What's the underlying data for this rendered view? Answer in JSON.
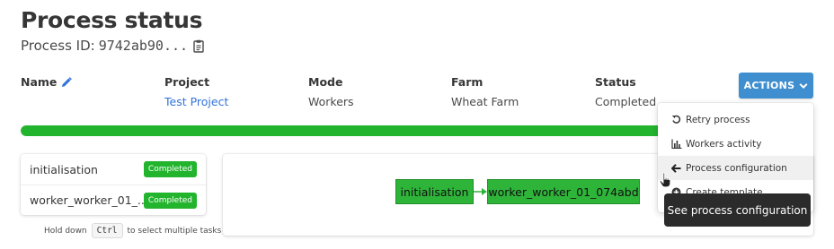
{
  "header": {
    "title": "Process status",
    "process_id_label": "Process ID:",
    "process_id_value": "9742ab90...",
    "icons": {
      "copy": "clipboard-icon",
      "edit": "pencil-icon"
    }
  },
  "fields": {
    "name_label": "Name",
    "project_label": "Project",
    "project_value": "Test Project",
    "mode_label": "Mode",
    "mode_value": "Workers",
    "farm_label": "Farm",
    "farm_value": "Wheat Farm",
    "status_label": "Status",
    "status_value": "Completed"
  },
  "actions": {
    "label": "ACTIONS",
    "icon": "chevron-down-icon",
    "color": "#3e8ed0"
  },
  "progress": {
    "fraction": 1.0,
    "color": "#23b42e"
  },
  "tasks": [
    {
      "name": "initialisation",
      "status": "Completed"
    },
    {
      "name": "worker_worker_01_...",
      "status": "Completed"
    }
  ],
  "hint": {
    "before": "Hold down",
    "key": "Ctrl",
    "after": "to select multiple tasks"
  },
  "graph": {
    "nodes": [
      "initialisation",
      "worker_worker_01_074abd"
    ],
    "node_color": "#2fb43a"
  },
  "menu": {
    "items": [
      {
        "label": "Retry process",
        "icon": "retry-icon"
      },
      {
        "label": "Workers activity",
        "icon": "bar-chart-icon"
      },
      {
        "label": "Process configuration",
        "icon": "arrow-left-icon"
      },
      {
        "label": "Create template",
        "icon": "plus-circle-icon"
      }
    ]
  },
  "tooltip": {
    "text": "See process configuration"
  }
}
